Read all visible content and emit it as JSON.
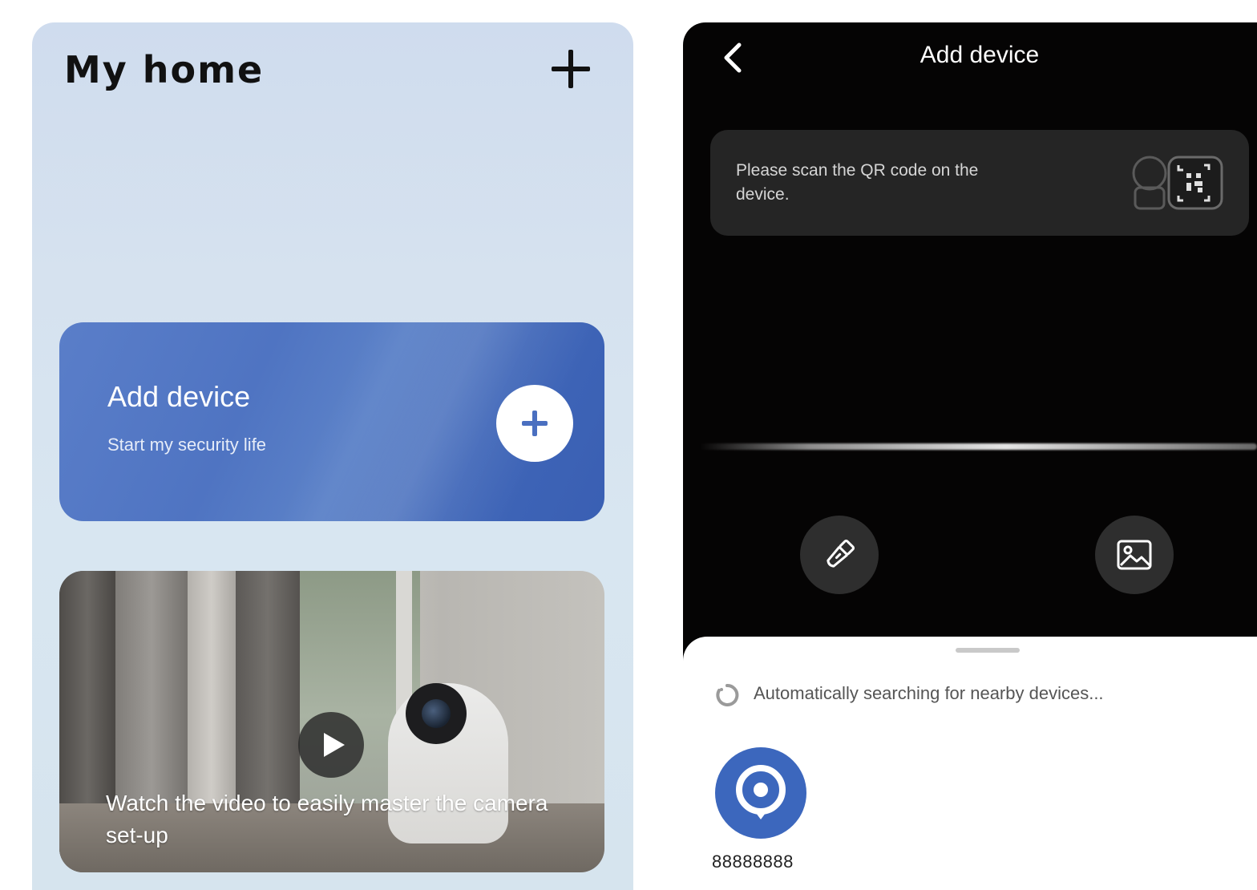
{
  "home_screen": {
    "title": "My home",
    "add_icon": "plus-icon",
    "add_device_card": {
      "title": "Add device",
      "subtitle": "Start my security life",
      "button_icon": "plus-icon"
    },
    "video_card": {
      "caption": "Watch the video to easily master the camera set-up",
      "play_icon": "play-icon"
    }
  },
  "scan_screen": {
    "title": "Add device",
    "back_icon": "chevron-left-icon",
    "qr_hint": "Please scan the QR code on the device.",
    "qr_illustration_icon": "camera-qr-icon",
    "torch_icon": "flashlight-icon",
    "gallery_icon": "image-icon",
    "nearby": {
      "status_text": "Automatically searching for nearby devices...",
      "spinner_icon": "loading-icon",
      "devices": [
        {
          "name": "88888888",
          "icon": "camera-device-icon"
        }
      ]
    }
  },
  "colors": {
    "accent_blue": "#3c67bd",
    "card_blue": "#4f74c2",
    "dark_bg": "#050404",
    "hint_card_bg": "#252525"
  }
}
